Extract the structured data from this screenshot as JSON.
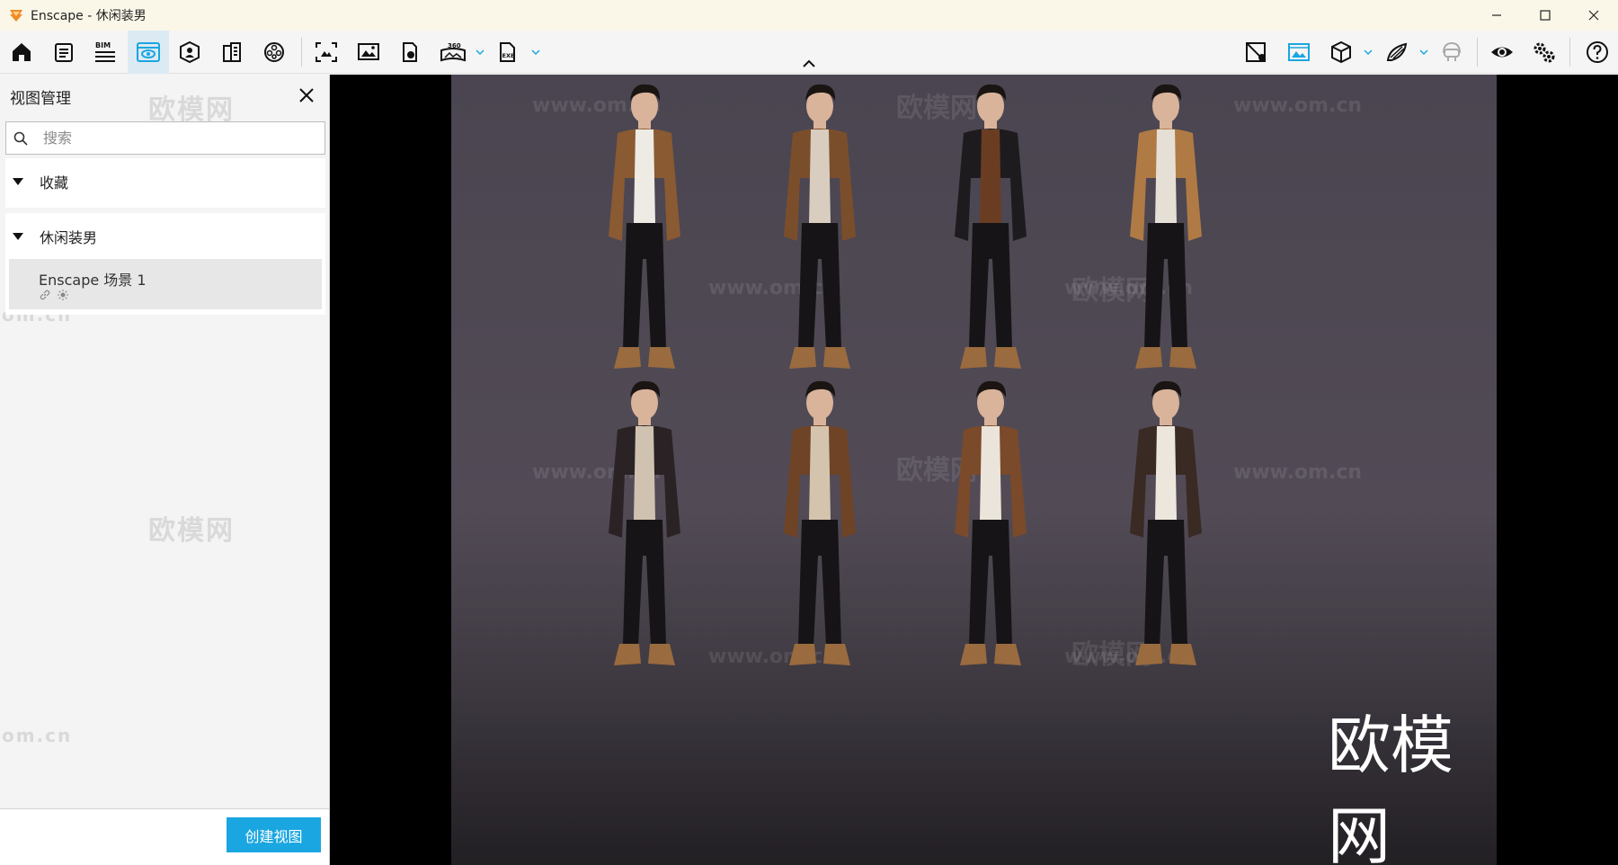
{
  "window": {
    "title": "Enscape - 休闲装男",
    "controls": [
      "minimize-icon",
      "maximize-icon",
      "close-icon"
    ]
  },
  "toolbar": {
    "left_icons": [
      "home-icon",
      "report-icon",
      "bim-icon",
      "views-icon",
      "asset-library-icon",
      "building-icon",
      "video-icon",
      "capture-icon",
      "screenshot-icon",
      "batch-render-icon",
      "panorama-360-icon",
      "export-exe-icon"
    ],
    "right_icons": [
      "materials-icon",
      "sync-views-icon",
      "cube-icon",
      "material-editor-icon",
      "vr-headset-icon",
      "visibility-icon",
      "settings-icon",
      "help-icon"
    ],
    "bim_label": "BIM",
    "panorama_label": "360",
    "exe_label": "EXE",
    "active": "views-icon",
    "accent_color": "#1aa6e0"
  },
  "sidebar": {
    "title": "视图管理",
    "search": {
      "placeholder": "搜索",
      "value": ""
    },
    "sections": [
      {
        "label": "收藏",
        "expanded": true,
        "items": []
      },
      {
        "label": "休闲装男",
        "expanded": true,
        "items": [
          {
            "name": "Enscape 场景 1",
            "icons": [
              "link-icon",
              "sun-icon"
            ]
          }
        ]
      }
    ],
    "create_button": "创建视图",
    "watermark": "欧模网",
    "watermark_url": "om.cn"
  },
  "viewport": {
    "watermark_url": "www.om.cn",
    "watermark_brand": "欧模网",
    "logo_text": "欧模网"
  }
}
